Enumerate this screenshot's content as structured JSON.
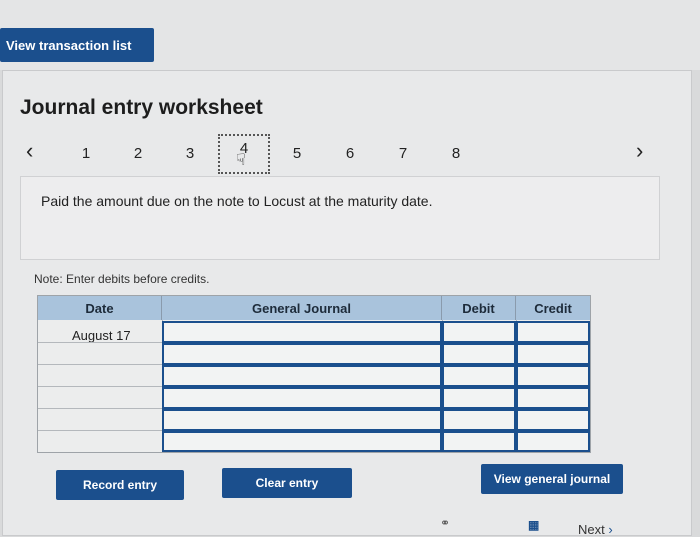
{
  "header": {
    "view_list_label": "View transaction list"
  },
  "worksheet": {
    "title": "Journal entry worksheet",
    "prev_icon": "chevron-left-icon",
    "next_icon": "chevron-right-icon",
    "tabs": [
      "1",
      "2",
      "3",
      "4",
      "5",
      "6",
      "7",
      "8"
    ],
    "active_tab": "4",
    "description": "Paid the amount due on the note to Locust at the maturity date.",
    "note": "Note: Enter debits before credits."
  },
  "table": {
    "headers": {
      "date": "Date",
      "journal": "General Journal",
      "debit": "Debit",
      "credit": "Credit"
    },
    "rows": [
      {
        "date": "August 17",
        "account": "",
        "debit": "",
        "credit": ""
      },
      {
        "date": "",
        "account": "",
        "debit": "",
        "credit": ""
      },
      {
        "date": "",
        "account": "",
        "debit": "",
        "credit": ""
      },
      {
        "date": "",
        "account": "",
        "debit": "",
        "credit": ""
      },
      {
        "date": "",
        "account": "",
        "debit": "",
        "credit": ""
      },
      {
        "date": "",
        "account": "",
        "debit": "",
        "credit": ""
      }
    ]
  },
  "buttons": {
    "record": "Record entry",
    "clear": "Clear entry",
    "view_journal": "View general journal"
  },
  "footer": {
    "next_label": "Next"
  },
  "colors": {
    "button_blue": "#1b4f8d",
    "header_blue": "#a9c3dc"
  }
}
